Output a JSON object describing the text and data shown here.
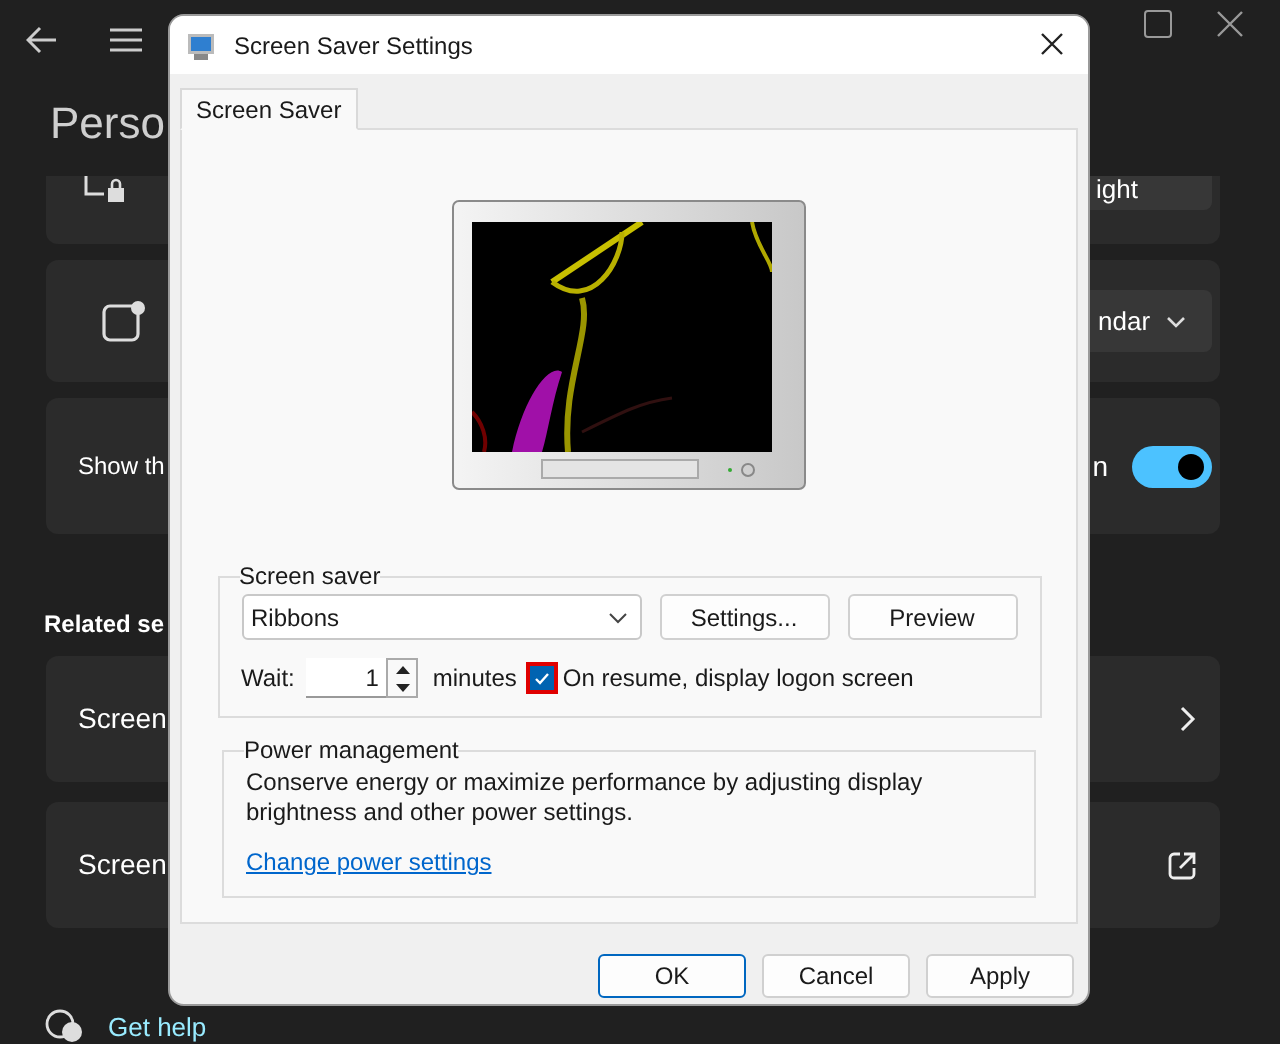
{
  "background_app": {
    "page_title": "Perso",
    "cards": [
      {
        "kind": "button",
        "value": "ight"
      },
      {
        "kind": "dropdown",
        "value": "ndar"
      },
      {
        "kind": "toggle",
        "label": "Show th",
        "value": "n",
        "on": true
      }
    ],
    "related_heading": "Related se",
    "related": [
      {
        "kind": "chevron",
        "label": "Screen"
      },
      {
        "kind": "external",
        "label": "Screen"
      }
    ],
    "help_link": "Get help"
  },
  "dialog": {
    "title": "Screen Saver Settings",
    "tabs": [
      {
        "label": "Screen Saver",
        "selected": true
      }
    ],
    "screen_saver": {
      "group_label": "Screen saver",
      "selected": "Ribbons",
      "buttons": [
        "Settings...",
        "Preview"
      ],
      "wait_label": "Wait:",
      "wait_value": "1",
      "wait_unit": "minutes",
      "logon_checkbox": {
        "label": "On resume, display logon screen",
        "checked": true
      }
    },
    "power": {
      "group_label": "Power management",
      "description": "Conserve energy or maximize performance by adjusting display brightness and other power settings.",
      "link": "Change power settings"
    },
    "buttons": [
      {
        "label": "OK",
        "default": true
      },
      {
        "label": "Cancel",
        "default": false
      },
      {
        "label": "Apply",
        "default": false
      }
    ]
  }
}
